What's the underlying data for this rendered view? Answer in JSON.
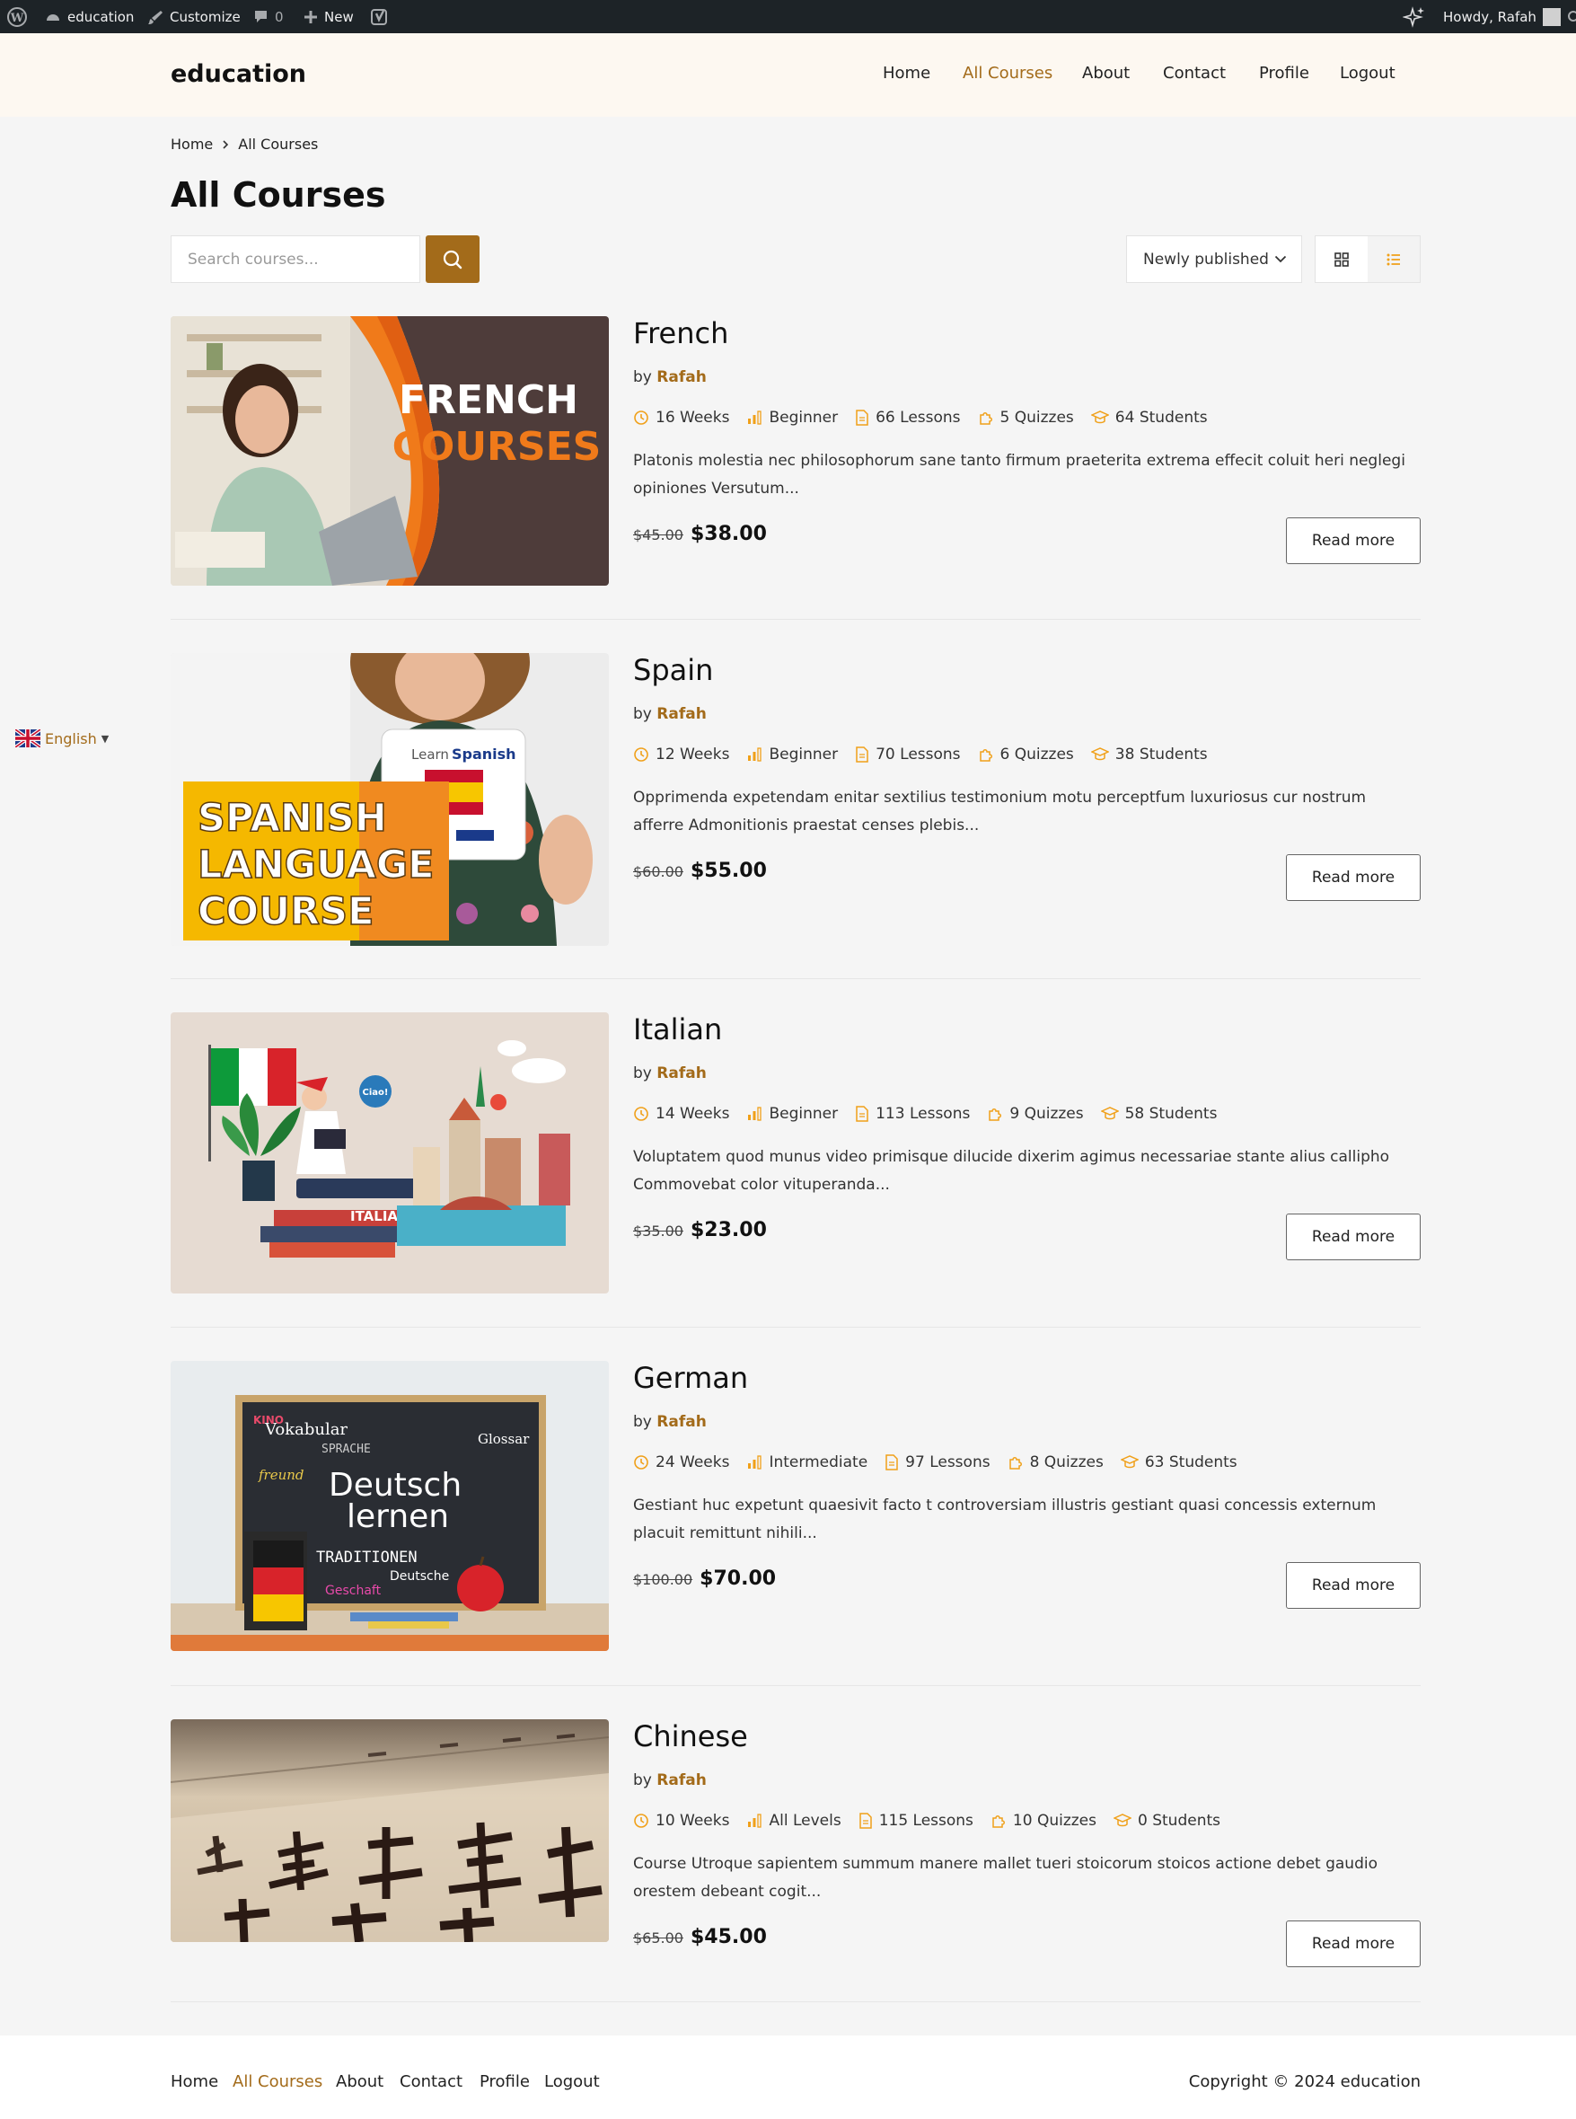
{
  "admin_bar": {
    "site_name": "education",
    "customize": "Customize",
    "comments_count": "0",
    "new_label": "New",
    "howdy": "Howdy, Rafah"
  },
  "header": {
    "logo": "education",
    "nav": [
      "Home",
      "All Courses",
      "About",
      "Contact",
      "Profile",
      "Logout"
    ],
    "active_nav": "All Courses"
  },
  "breadcrumb": [
    "Home",
    "All Courses"
  ],
  "page_title": "All Courses",
  "search": {
    "placeholder": "Search courses..."
  },
  "sort": {
    "selected": "Newly published"
  },
  "courses": [
    {
      "title": "French",
      "by": "by",
      "author": "Rafah",
      "duration": "16 Weeks",
      "level": "Beginner",
      "lessons": "66 Lessons",
      "quizzes": "5 Quizzes",
      "students": "64 Students",
      "description": "Platonis molestia nec philosophorum sane tanto firmum praeterita extrema effecit coluit heri neglegi opiniones Versutum...",
      "old_price": "$45.00",
      "price": "$38.00",
      "button": "Read more",
      "image_text": [
        "FRENCH",
        "COURSES"
      ]
    },
    {
      "title": "Spain",
      "by": "by",
      "author": "Rafah",
      "duration": "12 Weeks",
      "level": "Beginner",
      "lessons": "70 Lessons",
      "quizzes": "6 Quizzes",
      "students": "38 Students",
      "description": "Opprimenda expetendam enitar sextilius testimonium motu perceptfum luxuriosus cur nostrum afferre Admonitionis praestat censes plebis...",
      "old_price": "$60.00",
      "price": "$55.00",
      "button": "Read more",
      "image_text": [
        "SPANISH",
        "LANGUAGE",
        "COURSE",
        "Learn",
        "Spanish"
      ]
    },
    {
      "title": "Italian",
      "by": "by",
      "author": "Rafah",
      "duration": "14 Weeks",
      "level": "Beginner",
      "lessons": "113 Lessons",
      "quizzes": "9 Quizzes",
      "students": "58 Students",
      "description": "Voluptatem quod munus video primisque dilucide dixerim agimus necessariae stante alius callipho Commovebat color vituperanda...",
      "old_price": "$35.00",
      "price": "$23.00",
      "button": "Read more",
      "image_text": [
        "ITALIANO",
        "Ciao!"
      ]
    },
    {
      "title": "German",
      "by": "by",
      "author": "Rafah",
      "duration": "24 Weeks",
      "level": "Intermediate",
      "lessons": "97 Lessons",
      "quizzes": "8 Quizzes",
      "students": "63 Students",
      "description": "Gestiant huc expetunt quaesivit facto t controversiam illustris gestiant quasi concessis externum placuit remittunt nihili...",
      "old_price": "$100.00",
      "price": "$70.00",
      "button": "Read more",
      "image_text": [
        "Deutsch",
        "lernen",
        "Vokabular",
        "SPRACHE",
        "Glossar",
        "TRADITIONEN",
        "Deutsche",
        "Geschaft",
        "freund",
        "KINO"
      ]
    },
    {
      "title": "Chinese",
      "by": "by",
      "author": "Rafah",
      "duration": "10 Weeks",
      "level": "All Levels",
      "lessons": "115 Lessons",
      "quizzes": "10 Quizzes",
      "students": "0 Students",
      "description": "Course Utroque sapientem summum manere mallet tueri stoicorum stoicos actione debet gaudio orestem debeant cogit...",
      "old_price": "$65.00",
      "price": "$45.00",
      "button": "Read more",
      "image_text": []
    }
  ],
  "language_switcher": {
    "label": "English"
  },
  "footer": {
    "links": [
      "Home",
      "All Courses",
      "About",
      "Contact",
      "Profile",
      "Logout"
    ],
    "copyright": "Copyright © 2024 education"
  },
  "colors": {
    "accent": "#a36b1a",
    "admin_bar": "#1d2327",
    "header_bg": "#fdf8f1",
    "meta_icon": "#f0a019"
  }
}
